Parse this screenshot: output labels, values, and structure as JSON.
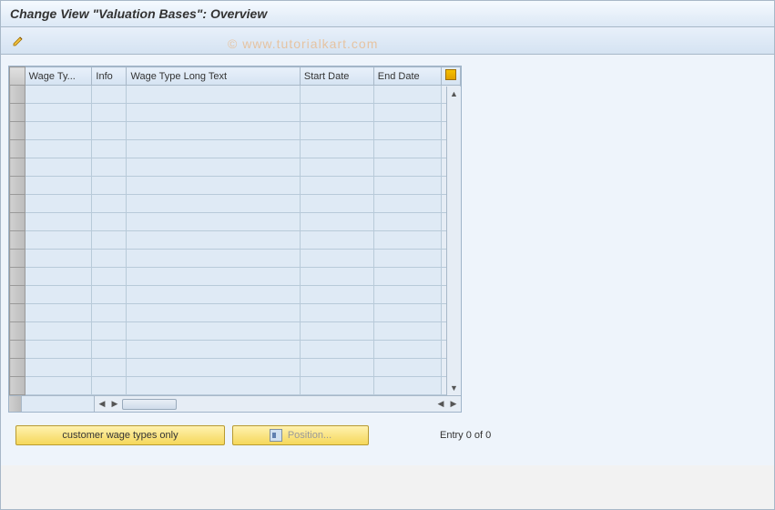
{
  "title": "Change View \"Valuation Bases\": Overview",
  "watermark": "© www.tutorialkart.com",
  "columns": {
    "c1": "Wage Ty...",
    "c2": "Info",
    "c3": "Wage Type Long Text",
    "c4": "Start Date",
    "c5": "End Date"
  },
  "buttons": {
    "customer": "customer wage types only",
    "position": "Position..."
  },
  "status": {
    "entry": "Entry 0 of 0"
  },
  "row_count": 17
}
